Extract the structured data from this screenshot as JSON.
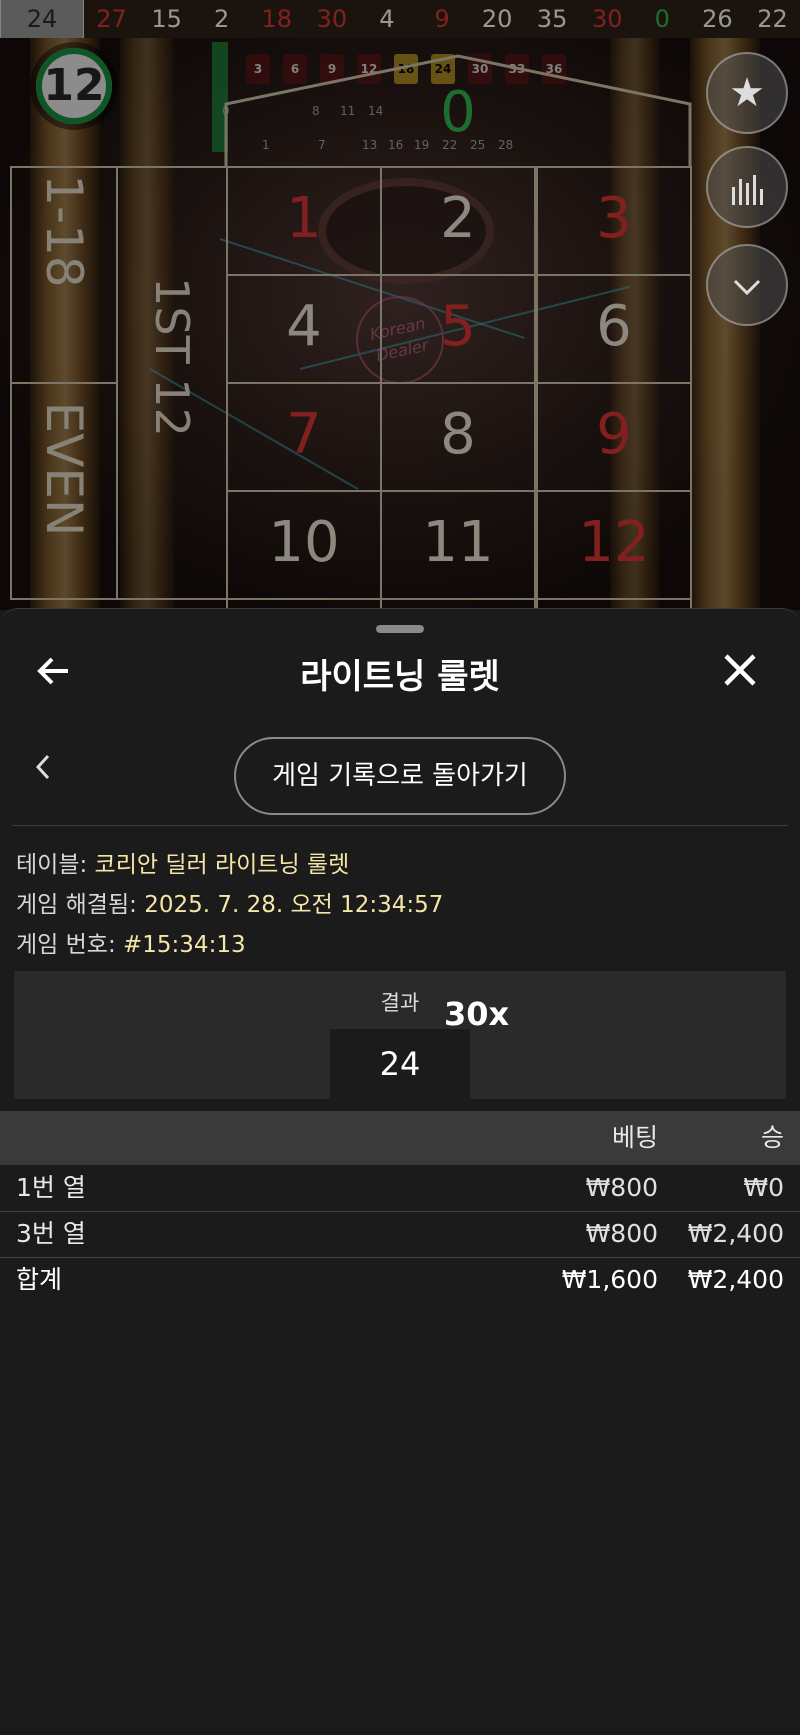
{
  "history_strip": [
    {
      "value": "24",
      "color": "white",
      "latest": true
    },
    {
      "value": "27",
      "color": "red"
    },
    {
      "value": "15",
      "color": "white"
    },
    {
      "value": "2",
      "color": "white"
    },
    {
      "value": "18",
      "color": "red"
    },
    {
      "value": "30",
      "color": "red"
    },
    {
      "value": "4",
      "color": "white"
    },
    {
      "value": "9",
      "color": "red"
    },
    {
      "value": "20",
      "color": "white"
    },
    {
      "value": "35",
      "color": "white"
    },
    {
      "value": "30",
      "color": "red"
    },
    {
      "value": "0",
      "color": "green"
    },
    {
      "value": "26",
      "color": "white"
    },
    {
      "value": "22",
      "color": "white"
    }
  ],
  "timer": {
    "value": "12"
  },
  "board": {
    "zero": "0",
    "numbers": [
      {
        "n": "1",
        "color": "red"
      },
      {
        "n": "2",
        "color": "white"
      },
      {
        "n": "3",
        "color": "red"
      },
      {
        "n": "4",
        "color": "white"
      },
      {
        "n": "5",
        "color": "red"
      },
      {
        "n": "6",
        "color": "white"
      },
      {
        "n": "7",
        "color": "red"
      },
      {
        "n": "8",
        "color": "white"
      },
      {
        "n": "9",
        "color": "red"
      },
      {
        "n": "10",
        "color": "white"
      },
      {
        "n": "11",
        "color": "white"
      },
      {
        "n": "12",
        "color": "red"
      }
    ],
    "outside_low": "1-18",
    "outside_even": "EVEN",
    "dozen": "1ST 12",
    "mini_chips": [
      "3",
      "6",
      "9",
      "12",
      "18",
      "24",
      "30",
      "33",
      "36"
    ],
    "mini_numbers": [
      "8",
      "11",
      "14",
      "1",
      "7",
      "13",
      "16",
      "19",
      "22",
      "25",
      "28",
      "0"
    ],
    "dealer_logo": "Korean Dealer"
  },
  "side_buttons": [
    {
      "name": "favorite",
      "icon": "star-icon"
    },
    {
      "name": "statistics",
      "icon": "bar-chart-icon"
    },
    {
      "name": "collapse",
      "icon": "chevron-down-icon"
    }
  ],
  "sheet": {
    "title": "라이트닝 룰렛",
    "return_label": "게임 기록으로 돌아가기",
    "table_label": "테이블:",
    "table_value": "코리안 딜러 라이트닝 룰렛",
    "resolved_label": "게임 해결됨:",
    "resolved_value": "2025. 7. 28. 오전 12:34:57",
    "game_no_label": "게임 번호:",
    "game_no_value": "#15:34:13",
    "result_label": "결과",
    "result_value": "24",
    "multiplier": "30x",
    "columns": {
      "bet": "베팅",
      "win": "승"
    },
    "rows": [
      {
        "label": "1번 열",
        "bet": "₩800",
        "win": "₩0"
      },
      {
        "label": "3번 열",
        "bet": "₩800",
        "win": "₩2,400"
      }
    ],
    "total": {
      "label": "합계",
      "bet": "₩1,600",
      "win": "₩2,400"
    }
  },
  "colors": {
    "red": "#c83232",
    "green": "#2fa84a",
    "highlight": "#f4e6a8"
  }
}
